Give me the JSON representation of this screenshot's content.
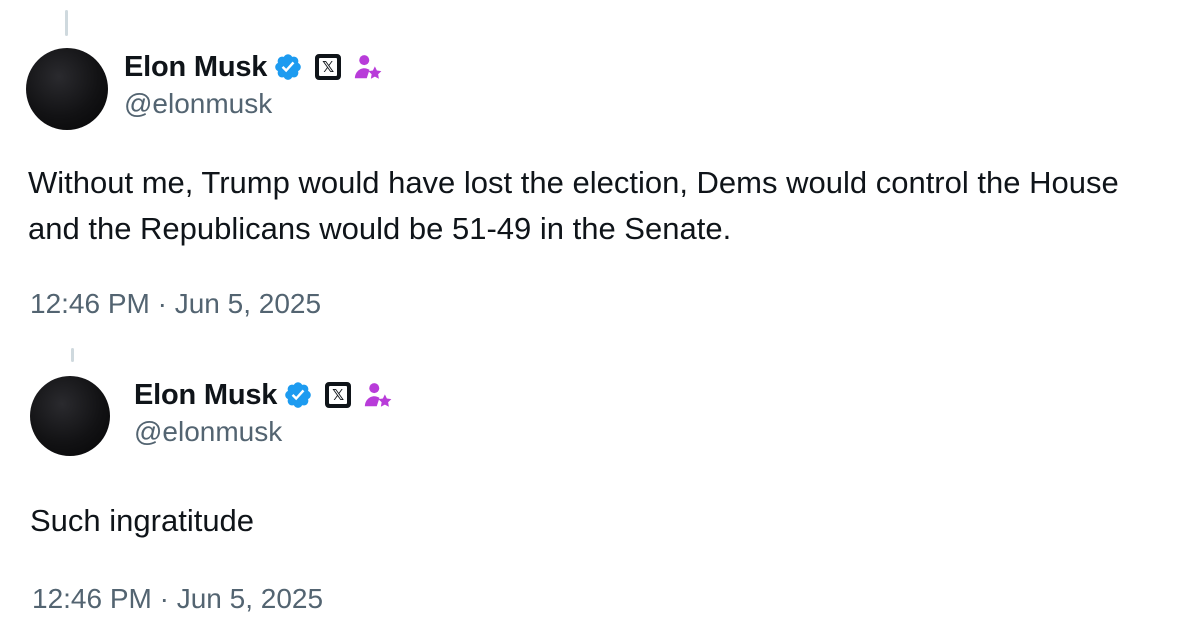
{
  "tweets": [
    {
      "author": {
        "display_name": "Elon Musk",
        "handle": "@elonmusk",
        "verified_icon": "verified-check-icon",
        "affiliate_icon": "x-logo-icon",
        "gov_icon": "person-star-icon"
      },
      "text": "Without me, Trump would have lost the election, Dems would control the House and the Republicans would be 51-49 in the Senate.",
      "timestamp": "12:46 PM · Jun 5, 2025"
    },
    {
      "author": {
        "display_name": "Elon Musk",
        "handle": "@elonmusk",
        "verified_icon": "verified-check-icon",
        "affiliate_icon": "x-logo-icon",
        "gov_icon": "person-star-icon"
      },
      "text": "Such ingratitude",
      "timestamp": "12:46 PM · Jun 5, 2025"
    }
  ],
  "colors": {
    "verified_blue": "#1d9bf0",
    "gov_purple": "#b83cd9",
    "secondary_text": "#536471",
    "primary_text": "#0f1419"
  }
}
